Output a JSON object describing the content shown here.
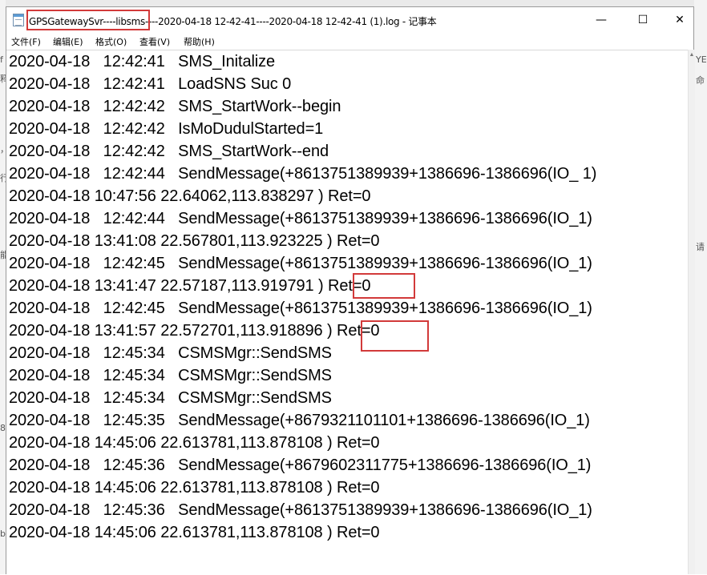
{
  "window": {
    "title": "GPSGatewaySvr----libsms----2020-04-18 12-42-41----2020-04-18 12-42-41 (1).log - 记事本",
    "minimize_glyph": "—",
    "maximize_glyph": "☐",
    "close_glyph": "✕"
  },
  "menu": {
    "items": [
      {
        "label": "文件(F)"
      },
      {
        "label": "编辑(E)"
      },
      {
        "label": "格式(O)"
      },
      {
        "label": "查看(V)"
      },
      {
        "label": "帮助(H)"
      }
    ]
  },
  "log_lines": [
    "2020-04-18   12:42:41   SMS_Initalize",
    "2020-04-18   12:42:41   LoadSNS Suc 0",
    "2020-04-18   12:42:42   SMS_StartWork--begin",
    "2020-04-18   12:42:42   IsMoDudulStarted=1",
    "2020-04-18   12:42:42   SMS_StartWork--end",
    "2020-04-18   12:42:44   SendMessage(+8613751389939+1386696-1386696(IO_ 1)",
    "2020-04-18 10:47:56 22.64062,113.838297 ) Ret=0",
    "2020-04-18   12:42:44   SendMessage(+8613751389939+1386696-1386696(IO_1)",
    "2020-04-18 13:41:08 22.567801,113.923225 ) Ret=0",
    "2020-04-18   12:42:45   SendMessage(+8613751389939+1386696-1386696(IO_1)",
    "2020-04-18 13:41:47 22.57187,113.919791 ) Ret=0",
    "2020-04-18   12:42:45   SendMessage(+8613751389939+1386696-1386696(IO_1)",
    "2020-04-18 13:41:57 22.572701,113.918896 ) Ret=0",
    "2020-04-18   12:45:34   CSMSMgr::SendSMS",
    "2020-04-18   12:45:34   CSMSMgr::SendSMS",
    "2020-04-18   12:45:34   CSMSMgr::SendSMS",
    "2020-04-18   12:45:35   SendMessage(+8679321101101+1386696-1386696(IO_1)",
    "2020-04-18 14:45:06 22.613781,113.878108 ) Ret=0",
    "2020-04-18   12:45:36   SendMessage(+8679602311775+1386696-1386696(IO_1)",
    "2020-04-18 14:45:06 22.613781,113.878108 ) Ret=0",
    "2020-04-18   12:45:36   SendMessage(+8613751389939+1386696-1386696(IO_1)",
    "2020-04-18 14:45:06 22.613781,113.878108 ) Ret=0"
  ],
  "annotation_color": "#d23a3a",
  "background": {
    "left_edge_fragments": [
      "f",
      "释",
      "，",
      "行",
      "能",
      "8",
      "b"
    ],
    "right_edge_fragments": [
      "YE",
      "命",
      "请"
    ]
  }
}
